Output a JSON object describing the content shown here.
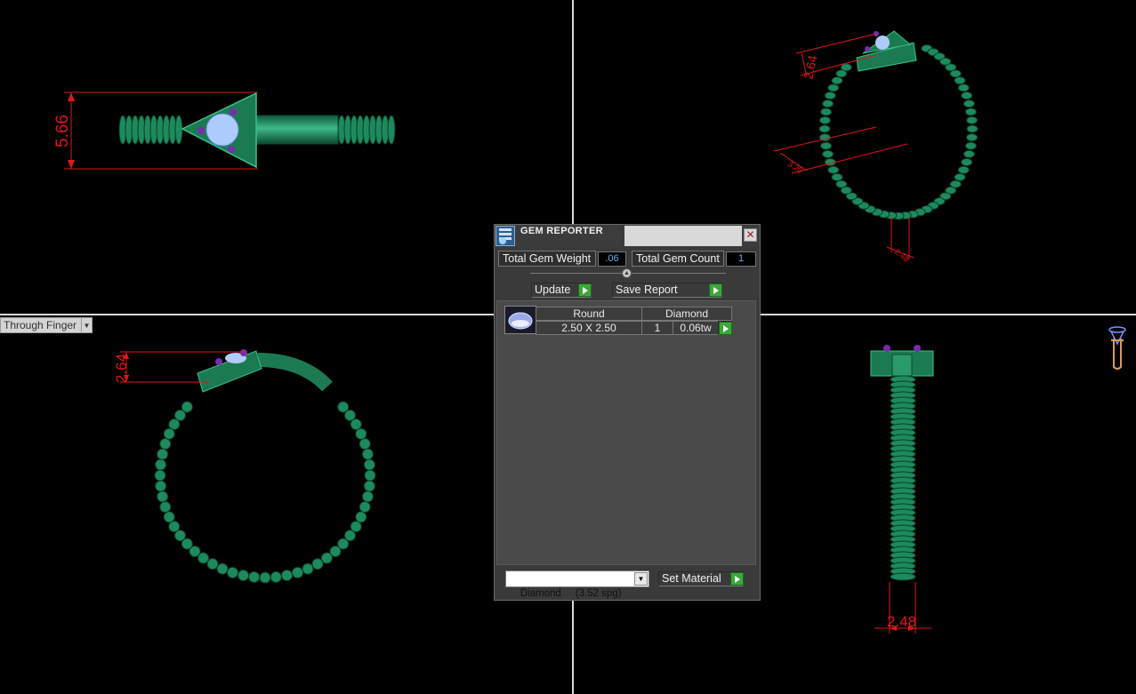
{
  "app": {
    "view_mode": "Through Finger"
  },
  "viewports": {
    "top_left": {
      "dimension": "5.66"
    },
    "top_right": {
      "dimension_top": "2.64",
      "dimension_mid": "3.20",
      "dimension_bottom": "2.48"
    },
    "bottom_left": {
      "dimension": "2.64"
    },
    "bottom_right": {
      "dimension": "2.48"
    }
  },
  "gem_reporter": {
    "title": "GEM REPORTER",
    "close_glyph": "✕",
    "total_weight_label": "Total Gem Weight",
    "total_weight_value": ".06",
    "total_count_label": "Total Gem Count",
    "total_count_value": "1",
    "update_label": "Update",
    "save_report_label": "Save Report",
    "table": {
      "headers": [
        "Round",
        "Diamond"
      ],
      "rows": [
        {
          "size": "2.50 X 2.50",
          "count": "1",
          "weight": "0.06tw"
        }
      ]
    },
    "material_select_value": "Diamond     (3.52 spg)",
    "set_material_label": "Set Material"
  },
  "colors": {
    "background": "#000000",
    "ring_green": "#1d8a5e",
    "dimension_red": "#e01818",
    "accent_go": "#3aa83a"
  },
  "icons": [
    "window-icon",
    "close-icon",
    "go-arrow-icon",
    "dropdown-arrow-icon",
    "slider-knob-icon",
    "camera-gizmo-icon"
  ]
}
